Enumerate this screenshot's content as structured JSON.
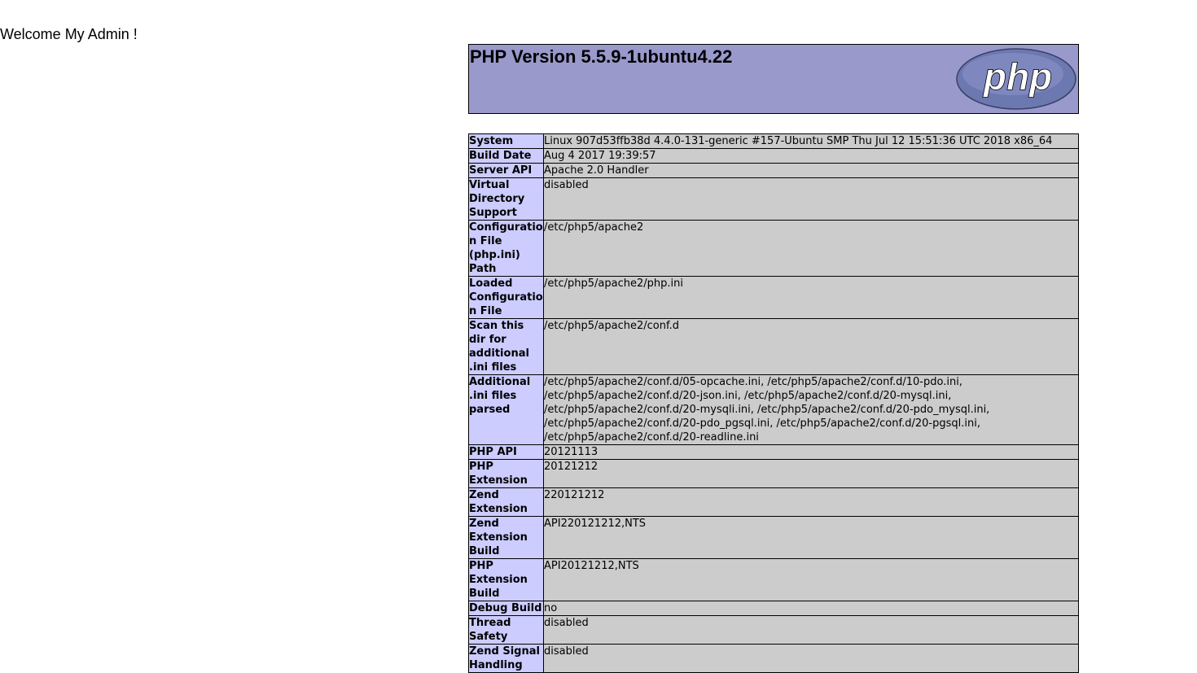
{
  "welcome_text": "Welcome My Admin !",
  "header": {
    "title": "PHP Version 5.5.9-1ubuntu4.22",
    "logo": "php-logo",
    "logo_text": "php",
    "colors": {
      "header_bg": "#9999cc",
      "label_bg": "#ccccff",
      "value_bg": "#cccccc"
    }
  },
  "rows": [
    {
      "label": "System",
      "value": "Linux 907d53ffb38d 4.4.0-131-generic #157-Ubuntu SMP Thu Jul 12 15:51:36 UTC 2018 x86_64"
    },
    {
      "label": "Build Date",
      "value": "Aug 4 2017 19:39:57"
    },
    {
      "label": "Server API",
      "value": "Apache 2.0 Handler"
    },
    {
      "label": "Virtual Directory Support",
      "value": "disabled"
    },
    {
      "label": "Configuration File (php.ini) Path",
      "value": "/etc/php5/apache2"
    },
    {
      "label": "Loaded Configuration File",
      "value": "/etc/php5/apache2/php.ini"
    },
    {
      "label": "Scan this dir for additional .ini files",
      "value": "/etc/php5/apache2/conf.d"
    },
    {
      "label": "Additional .ini files parsed",
      "value": "/etc/php5/apache2/conf.d/05-opcache.ini, /etc/php5/apache2/conf.d/10-pdo.ini, /etc/php5/apache2/conf.d/20-json.ini, /etc/php5/apache2/conf.d/20-mysql.ini, /etc/php5/apache2/conf.d/20-mysqli.ini, /etc/php5/apache2/conf.d/20-pdo_mysql.ini, /etc/php5/apache2/conf.d/20-pdo_pgsql.ini, /etc/php5/apache2/conf.d/20-pgsql.ini, /etc/php5/apache2/conf.d/20-readline.ini"
    },
    {
      "label": "PHP API",
      "value": "20121113"
    },
    {
      "label": "PHP Extension",
      "value": "20121212"
    },
    {
      "label": "Zend Extension",
      "value": "220121212"
    },
    {
      "label": "Zend Extension Build",
      "value": "API220121212,NTS"
    },
    {
      "label": "PHP Extension Build",
      "value": "API20121212,NTS"
    },
    {
      "label": "Debug Build",
      "value": "no"
    },
    {
      "label": "Thread Safety",
      "value": "disabled"
    },
    {
      "label": "Zend Signal Handling",
      "value": "disabled"
    }
  ]
}
